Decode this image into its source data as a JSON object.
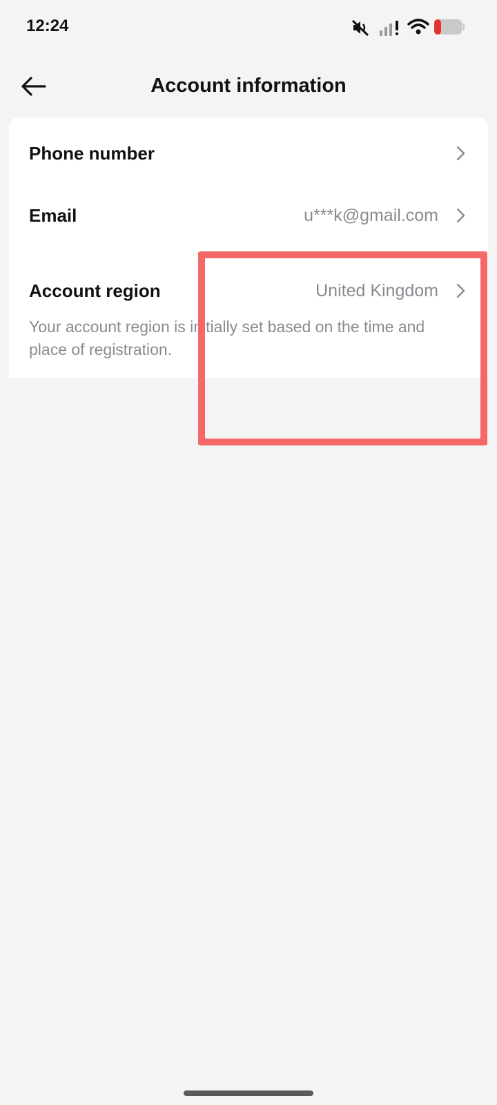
{
  "status_bar": {
    "time": "12:24",
    "icons": [
      "mute-icon",
      "signal-icon",
      "wifi-icon",
      "battery-icon"
    ],
    "battery_color": "#e5322d"
  },
  "header": {
    "title": "Account information",
    "back_icon": "back-arrow-icon"
  },
  "account": {
    "rows": [
      {
        "label": "Phone number",
        "value": ""
      },
      {
        "label": "Email",
        "value": "u***k@gmail.com"
      }
    ],
    "region": {
      "label": "Account region",
      "value": "United Kingdom",
      "note": "Your account region is initially set based on the time and place of registration."
    }
  },
  "colors": {
    "background": "#f4f4f4",
    "card": "#ffffff",
    "secondary_text": "#8a8b91",
    "highlight": "#f56868"
  }
}
